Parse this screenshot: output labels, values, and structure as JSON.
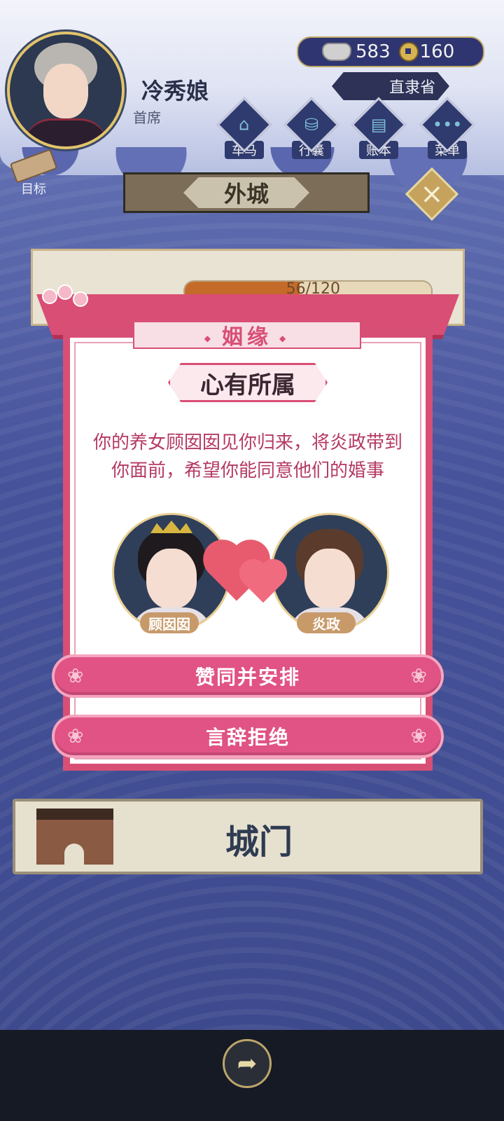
{
  "player": {
    "name": "冷秀娘",
    "rank": "首席"
  },
  "currency": {
    "silver": "583",
    "coins": "160",
    "silver_icon": "silver-ingot-icon",
    "coin_icon": "copper-coin-icon"
  },
  "region": "直隶省",
  "nav": {
    "items": [
      {
        "label": "车马",
        "icon": "carriage-icon"
      },
      {
        "label": "行囊",
        "icon": "bag-icon"
      },
      {
        "label": "账本",
        "icon": "ledger-icon"
      },
      {
        "label": "菜单",
        "icon": "menu-icon"
      }
    ]
  },
  "goal_label": "目标",
  "location": "外城",
  "stamina": {
    "value": "56/120",
    "fraction": 0.4667
  },
  "gate_label": "城门",
  "modal": {
    "title": "姻缘",
    "subtitle": "心有所属",
    "message": "你的养女顾囡囡见你归来，将炎政带到你面前，希望你能同意他们的婚事",
    "left_name": "顾囡囡",
    "right_name": "炎政",
    "approve_label": "赞同并安排",
    "reject_label": "言辞拒绝"
  },
  "colors": {
    "accent": "#d84f75",
    "button": "#e05384",
    "text": "#b53a64"
  }
}
